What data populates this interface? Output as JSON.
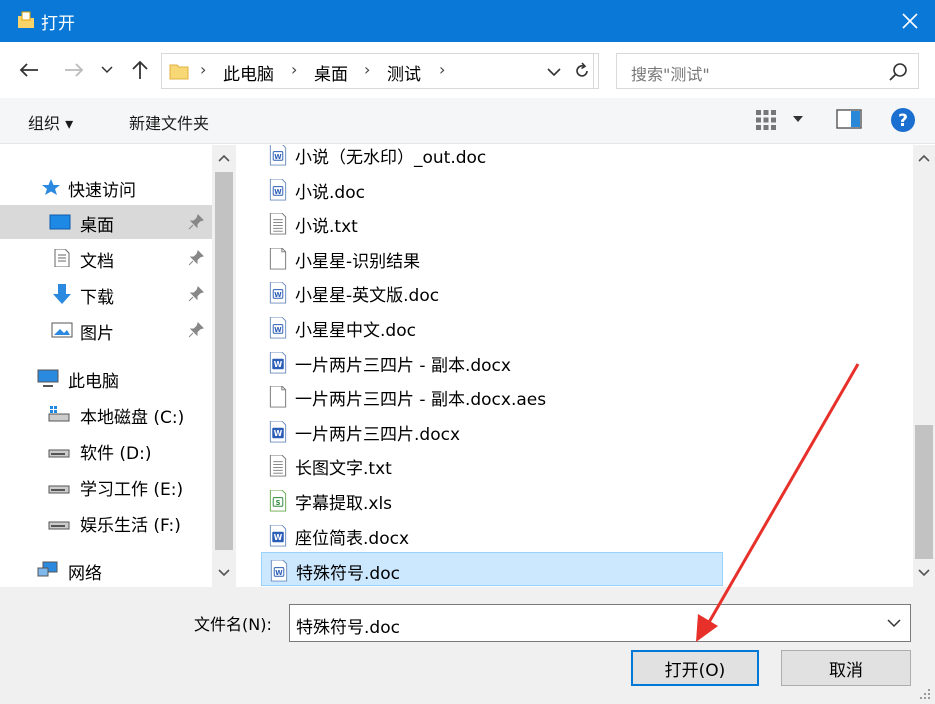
{
  "window": {
    "title": "打开"
  },
  "address": {
    "crumbs": [
      "此电脑",
      "桌面",
      "测试"
    ],
    "search_placeholder": "搜索\"测试\""
  },
  "toolbar": {
    "organize_label": "组织 ▾",
    "new_folder_label": "新建文件夹"
  },
  "nav": {
    "quick_access": "快速访问",
    "pinned": [
      "桌面",
      "文档",
      "下载",
      "图片"
    ],
    "this_pc": "此电脑",
    "drives": [
      "本地磁盘 (C:)",
      "软件 (D:)",
      "学习工作 (E:)",
      "娱乐生活 (F:)"
    ],
    "network": "网络"
  },
  "files": [
    {
      "name": "小说（无水印）_out.doc",
      "type": "doc"
    },
    {
      "name": "小说.doc",
      "type": "doc"
    },
    {
      "name": "小说.txt",
      "type": "txt"
    },
    {
      "name": "小星星-识别结果",
      "type": "blank"
    },
    {
      "name": "小星星-英文版.doc",
      "type": "doc"
    },
    {
      "name": "小星星中文.doc",
      "type": "doc"
    },
    {
      "name": "一片两片三四片 - 副本.docx",
      "type": "docx"
    },
    {
      "name": "一片两片三四片 - 副本.docx.aes",
      "type": "blank"
    },
    {
      "name": "一片两片三四片.docx",
      "type": "docx"
    },
    {
      "name": "长图文字.txt",
      "type": "txt"
    },
    {
      "name": "字幕提取.xls",
      "type": "xls"
    },
    {
      "name": "座位简表.docx",
      "type": "docx"
    },
    {
      "name": "特殊符号.doc",
      "type": "doc",
      "selected": true
    }
  ],
  "bottom": {
    "filename_label": "文件名(N):",
    "filename_value": "特殊符号.doc",
    "open_label": "打开(O)",
    "cancel_label": "取消"
  },
  "colors": {
    "titlebar": "#0a78d7",
    "selection": "#cce8ff",
    "annotation": "#e8302a"
  }
}
